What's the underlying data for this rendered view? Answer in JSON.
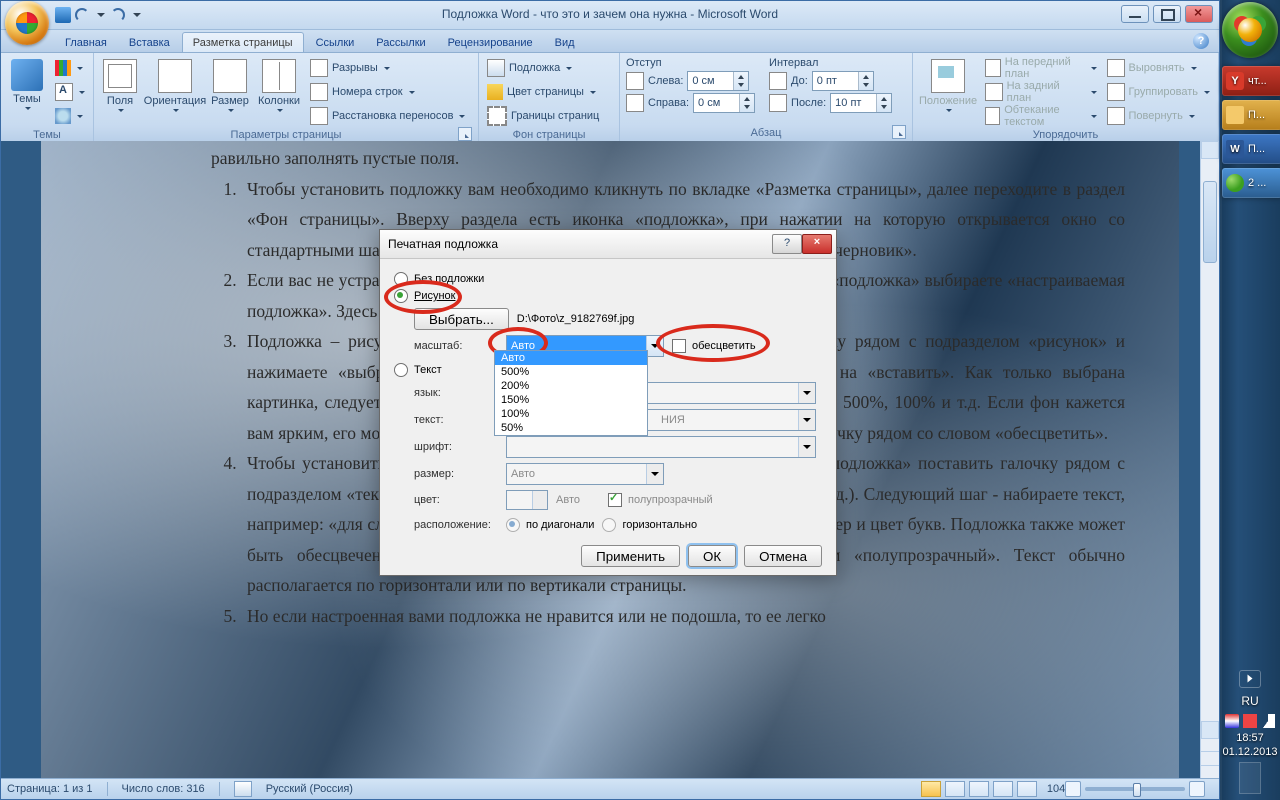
{
  "window": {
    "title": "Подложка Word - что это и зачем она нужна - Microsoft Word"
  },
  "tabs": {
    "home": "Главная",
    "insert": "Вставка",
    "layout": "Разметка страницы",
    "refs": "Ссылки",
    "mail": "Рассылки",
    "review": "Рецензирование",
    "view": "Вид"
  },
  "ribbon": {
    "themes": {
      "label": "Темы",
      "btn": "Темы"
    },
    "page_setup": {
      "label": "Параметры страницы",
      "margins": "Поля",
      "orientation": "Ориентация",
      "size": "Размер",
      "columns": "Колонки",
      "breaks": "Разрывы",
      "line_numbers": "Номера строк",
      "hyphenation": "Расстановка переносов"
    },
    "page_bg": {
      "label": "Фон страницы",
      "watermark": "Подложка",
      "pagecolor": "Цвет страницы",
      "pageborder": "Границы страниц"
    },
    "paragraph": {
      "label": "Абзац",
      "indent_title": "Отступ",
      "indent_left": "Слева:",
      "indent_left_val": "0 см",
      "indent_right": "Справа:",
      "indent_right_val": "0 см",
      "spacing_title": "Интервал",
      "before": "До:",
      "before_val": "0 пт",
      "after": "После:",
      "after_val": "10 пт"
    },
    "arrange": {
      "label": "Упорядочить",
      "position": "Положение",
      "bring_front": "На передний план",
      "send_back": "На задний план",
      "wrap": "Обтекание текстом",
      "align": "Выровнять",
      "group": "Группировать",
      "rotate": "Повернуть"
    }
  },
  "document": {
    "intro": "равильно заполнять пустые поля.",
    "items": [
      "Чтобы установить подложку вам необходимо кликнуть по вкладке «Разметка страницы», далее переходите в раздел «Фон страницы».  Вверху раздела есть иконка «подложка», при нажатии на которую открывается окно со стандартными шаблонами. Они представлены в двух вариантах: «образец» и «черновик».",
      "Если вас не устраивают предложенные стандарты, то в открывшемся окошке «подложка» выбираете «настраиваемая подложка».  Здесь два варианта оформления: рисунок или текст.",
      "Подложка – рисунок. В разделе «настраиваемая подложка» ставите галочку рядом с подразделом «рисунок» и нажимаете «выбрать». Находите необходимое вам изображение и жмете на «вставить». Как только выбрана картинка, следует установить ее масштаб. Здесь предлагается масштаб: авто, 500%, 100% и т.д. Если фон кажется вам ярким, его можно сделать полупрозрачным. Для этого устанавливаете галочку рядом со словом «обесцветить».",
      "Чтобы установить текст в подложке необходимо в разделе «настраиваемая подложка» поставить галочку рядом с подразделом «текст». Далее вы устанавливаете язык (русский, английский и т.д.). Следующий шаг  - набираете текст, например: «для служебного пользования». Устанавливаете шрифт текста, размер и цвет букв.  Подложка также может быть обесцвечена, для этого устанавливаете галочку рядом со словом «полупрозрачный». Текст обычно располагается по горизонтали или по вертикали страницы.",
      "Но если настроенная вами подложка не нравится или не подошла, то ее легко"
    ]
  },
  "dialog": {
    "title": "Печатная подложка",
    "opt_none": "Без подложки",
    "opt_picture": "Рисунок",
    "opt_text": "Текст",
    "choose": "Выбрать...",
    "file": "D:\\Фото\\z_9182769f.jpg",
    "lbl_scale": "масштаб:",
    "scale_value": "Авто",
    "washout": "обесцветить",
    "lbl_lang": "язык:",
    "lbl_text": "текст:",
    "text_value_hint": "НИЯ",
    "lbl_font": "шрифт:",
    "lbl_size": "размер:",
    "size_value": "Авто",
    "lbl_color": "цвет:",
    "color_value": "Авто",
    "semitransparent": "полупрозрачный",
    "lbl_layout": "расположение:",
    "layout_diag": "по диагонали",
    "layout_horiz": "горизонтально",
    "scale_options": [
      "Авто",
      "500%",
      "200%",
      "150%",
      "100%",
      "50%"
    ],
    "btn_apply": "Применить",
    "btn_ok": "ОК",
    "btn_cancel": "Отмена"
  },
  "status": {
    "page": "Страница: 1 из 1",
    "words": "Число слов: 316",
    "lang": "Русский (Россия)",
    "zoom": "104%"
  },
  "taskbar": {
    "yandex": "чт...",
    "p1": "П...",
    "p2": "П...",
    "msg": "2 ...",
    "lang": "RU",
    "time": "18:57",
    "date": "01.12.2013"
  }
}
